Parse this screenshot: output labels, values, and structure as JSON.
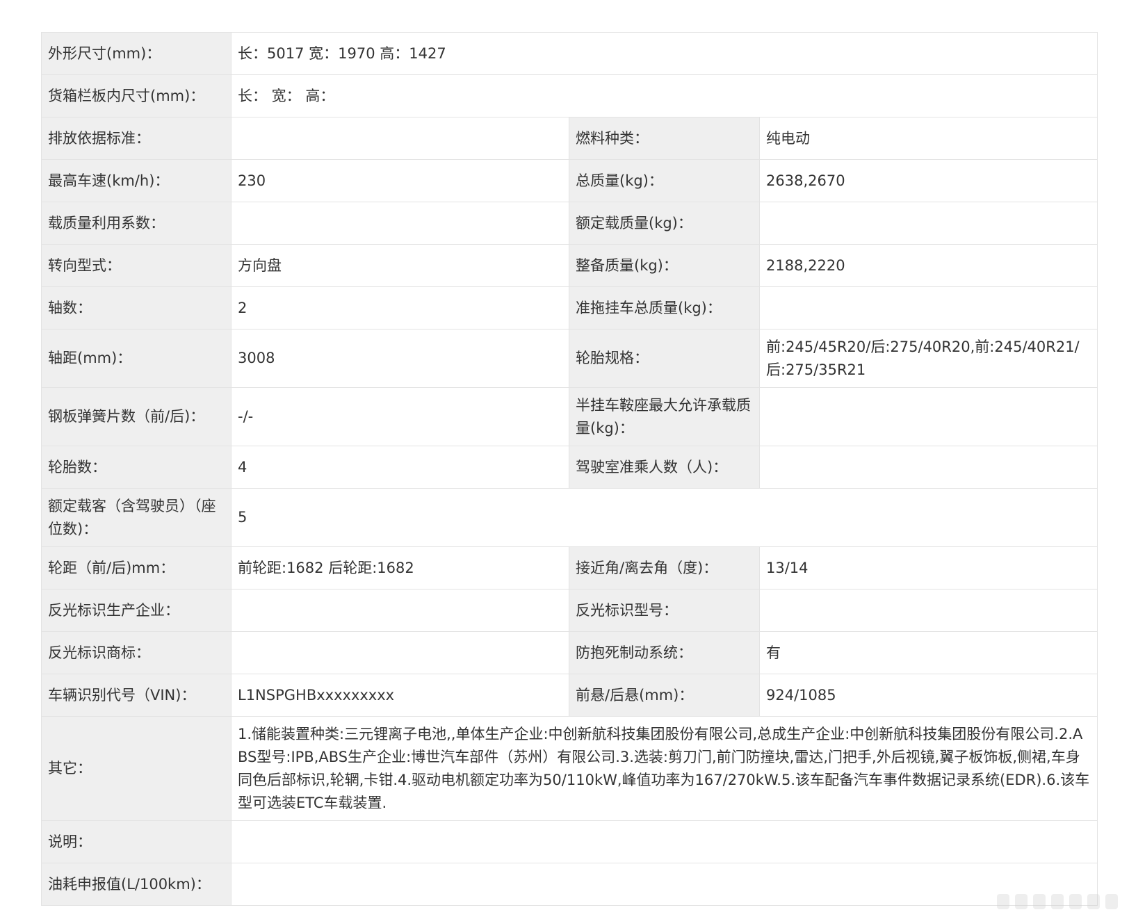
{
  "rows": [
    {
      "label": "外形尺寸(mm)：",
      "value": "长：5017 宽：1970 高：1427"
    },
    {
      "label": "货箱栏板内尺寸(mm)：",
      "value": "长：  宽：  高："
    },
    {
      "label": "排放依据标准：",
      "value": "",
      "label2": "燃料种类：",
      "value2": "纯电动"
    },
    {
      "label": "最高车速(km/h)：",
      "value": "230",
      "label2": "总质量(kg)：",
      "value2": "2638,2670"
    },
    {
      "label": "载质量利用系数：",
      "value": "",
      "label2": "额定载质量(kg)：",
      "value2": ""
    },
    {
      "label": "转向型式：",
      "value": "方向盘",
      "label2": "整备质量(kg)：",
      "value2": "2188,2220"
    },
    {
      "label": "轴数：",
      "value": "2",
      "label2": "准拖挂车总质量(kg)：",
      "value2": ""
    },
    {
      "label": "轴距(mm)：",
      "value": "3008",
      "label2": "轮胎规格：",
      "value2": "前:245/45R20/后:275/40R20,前:245/40R21/后:275/35R21"
    },
    {
      "label": "钢板弹簧片数（前/后)：",
      "value": "-/-",
      "label2": "半挂车鞍座最大允许承载质量(kg)：",
      "value2": ""
    },
    {
      "label": "轮胎数：",
      "value": "4",
      "label2": "驾驶室准乘人数（人)：",
      "value2": ""
    },
    {
      "label": "额定载客（含驾驶员）（座位数)：",
      "value": "5"
    },
    {
      "label": "轮距（前/后)mm：",
      "value": "前轮距:1682 后轮距:1682",
      "label2": "接近角/离去角（度)：",
      "value2": "13/14"
    },
    {
      "label": "反光标识生产企业：",
      "value": "",
      "label2": "反光标识型号：",
      "value2": ""
    },
    {
      "label": "反光标识商标：",
      "value": "",
      "label2": "防抱死制动系统：",
      "value2": "有"
    },
    {
      "label": "车辆识别代号（VIN)：",
      "value": "L1NSPGHBxxxxxxxxx",
      "label2": "前悬/后悬(mm)：",
      "value2": "924/1085"
    },
    {
      "label": "其它：",
      "value": "1.储能装置种类:三元锂离子电池,,单体生产企业:中创新航科技集团股份有限公司,总成生产企业:中创新航科技集团股份有限公司.2.ABS型号:IPB,ABS生产企业:博世汽车部件（苏州）有限公司.3.选装:剪刀门,前门防撞块,雷达,门把手,外后视镜,翼子板饰板,侧裙,车身同色后部标识,轮辋,卡钳.4.驱动电机额定功率为50/110kW,峰值功率为167/270kW.5.该车配备汽车事件数据记录系统(EDR).6.该车型可选装ETC车载装置."
    },
    {
      "label": "说明：",
      "value": ""
    },
    {
      "label": "油耗申报值(L/100km)：",
      "value": ""
    }
  ]
}
